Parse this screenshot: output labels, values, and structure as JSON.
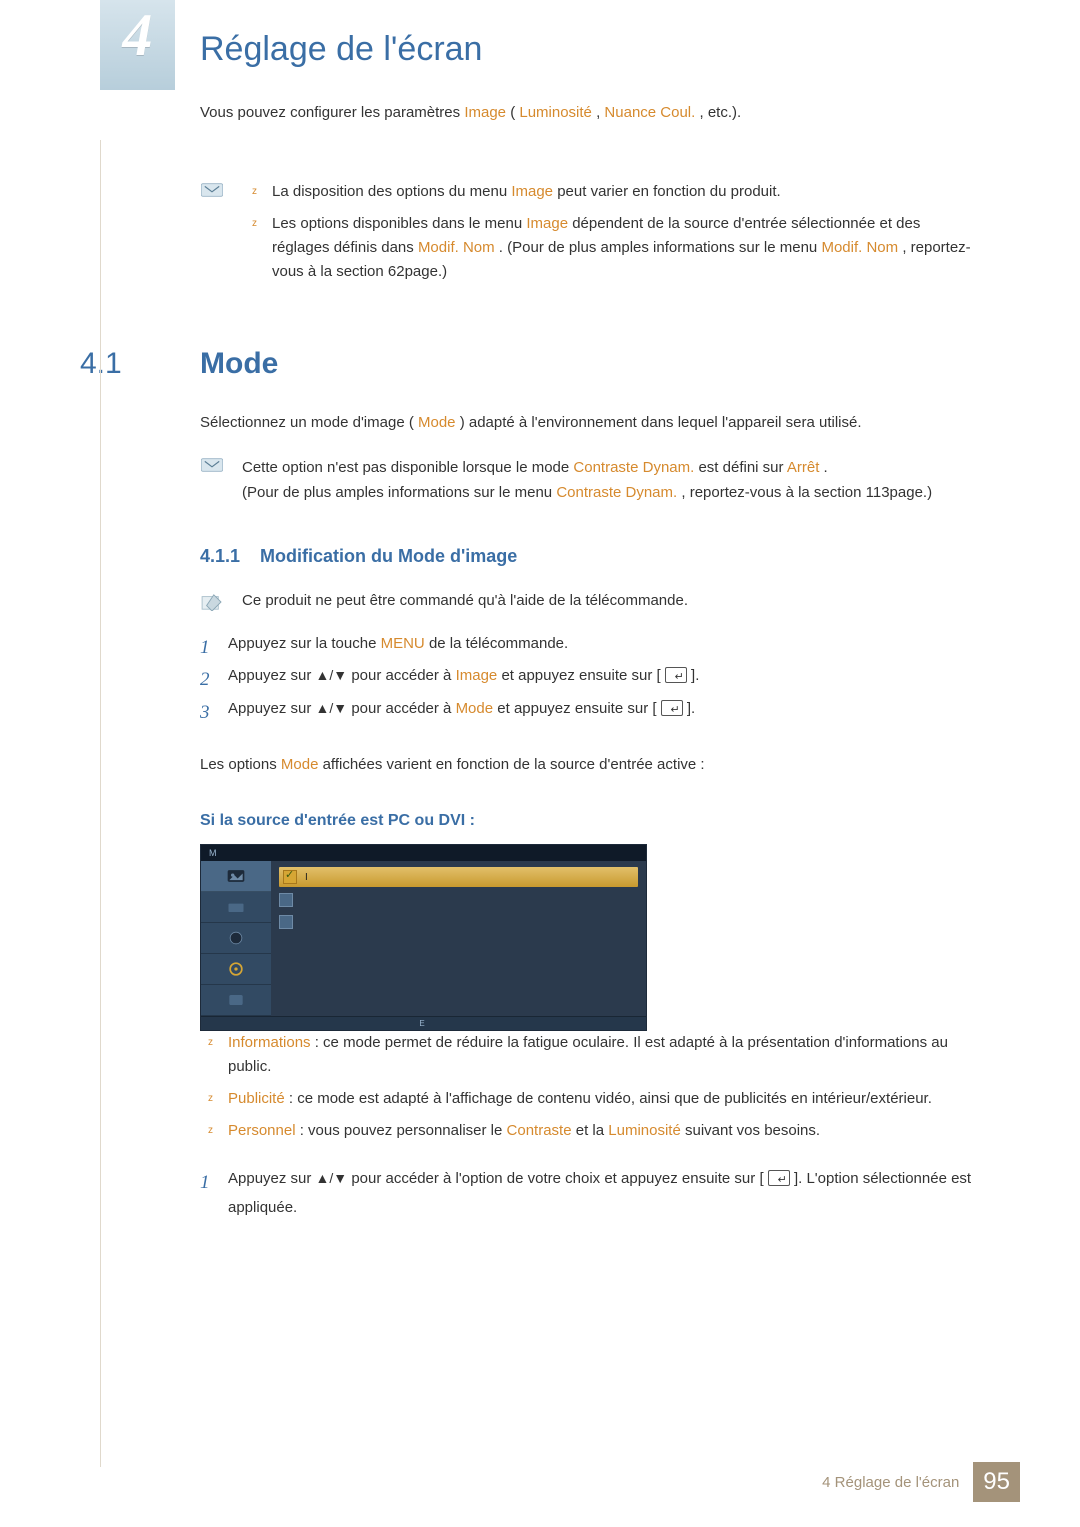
{
  "chapter": {
    "number": "4",
    "title": "Réglage de l'écran"
  },
  "intro": {
    "t1": "Vous pouvez configurer les paramètres ",
    "hl_image": "Image",
    "t2": " (",
    "hl_lum": "Luminosité",
    "t3": ", ",
    "hl_nuance": "Nuance Coul.",
    "t4": ", etc.)."
  },
  "top_notes": {
    "li1_a": "La disposition des options du menu ",
    "li1_hl": "Image",
    "li1_b": " peut varier en fonction du produit.",
    "li2_a": "Les options disponibles dans le menu ",
    "li2_hl1": "Image",
    "li2_b": " dépendent de la source d'entrée sélectionnée et des réglages définis dans ",
    "li2_hl2": "Modif. Nom",
    "li2_c": ". (Pour de plus amples informations sur le menu ",
    "li2_hl3": "Modif. Nom",
    "li2_d": ", reportez-vous à la section 62page.)"
  },
  "section": {
    "num": "4.1",
    "title": "Mode",
    "desc_a": "Sélectionnez un mode d'image (",
    "desc_hl": "Mode",
    "desc_b": ") adapté à l'environnement dans lequel l'appareil sera utilisé."
  },
  "section_note": {
    "l1_a": "Cette option n'est pas disponible lorsque le mode ",
    "l1_hl1": "Contraste Dynam.",
    "l1_b": " est défini sur ",
    "l1_hl2": "Arrêt",
    "l1_c": ".",
    "l2_a": "(Pour de plus amples informations sur le menu ",
    "l2_hl": "Contraste Dynam.",
    "l2_b": ", reportez-vous à la section 113page.)"
  },
  "subsection": {
    "num": "4.1.1",
    "title": "Modification du Mode d'image",
    "edit_note": "Ce produit ne peut être commandé qu'à l'aide de la télécommande."
  },
  "steps_a": {
    "s1_a": "Appuyez sur la touche ",
    "s1_hl": "MENU",
    "s1_b": " de la télécommande.",
    "s2_a": "Appuyez sur ",
    "s2_arrows": "▲/▼",
    "s2_b": " pour accéder à ",
    "s2_hl": "Image",
    "s2_c": " et appuyez ensuite sur [",
    "s2_d": "].",
    "s3_a": "Appuyez sur ",
    "s3_arrows": "▲/▼",
    "s3_b": " pour accéder à ",
    "s3_hl": "Mode",
    "s3_c": " et appuyez ensuite sur [",
    "s3_d": "]."
  },
  "mode_sentence_a": "Les options ",
  "mode_sentence_hl": "Mode",
  "mode_sentence_b": " affichées varient en fonction de la source d'entrée active :",
  "pc_dvi_heading": "Si la source d'entrée est PC ou DVI :",
  "osd": {
    "title_letter": "M",
    "rows": [
      {
        "label": "I",
        "selected": true
      },
      {
        "label": "",
        "selected": false
      },
      {
        "label": "",
        "selected": false
      }
    ],
    "footer_left": "",
    "footer_mid": "E",
    "footer_right": ""
  },
  "mode_list": {
    "li1_hl": "Informations",
    "li1_t": " : ce mode permet de réduire la fatigue oculaire. Il est adapté à la présentation d'informations au public.",
    "li2_hl": "Publicité",
    "li2_t": " : ce mode est adapté à l'affichage de contenu vidéo, ainsi que de publicités en intérieur/extérieur.",
    "li3_hl": "Personnel",
    "li3_a": " : vous pouvez personnaliser le ",
    "li3_hl2": "Contraste",
    "li3_b": " et la ",
    "li3_hl3": "Luminosité",
    "li3_c": " suivant vos besoins."
  },
  "steps_b": {
    "s1_a": "Appuyez sur ",
    "s1_arrows": "▲/▼",
    "s1_b": " pour accéder à l'option de votre choix et appuyez ensuite sur [",
    "s1_c": "]. L'option sélectionnée est appliquée."
  },
  "footer": {
    "text": "4 Réglage de l'écran",
    "page": "95"
  }
}
